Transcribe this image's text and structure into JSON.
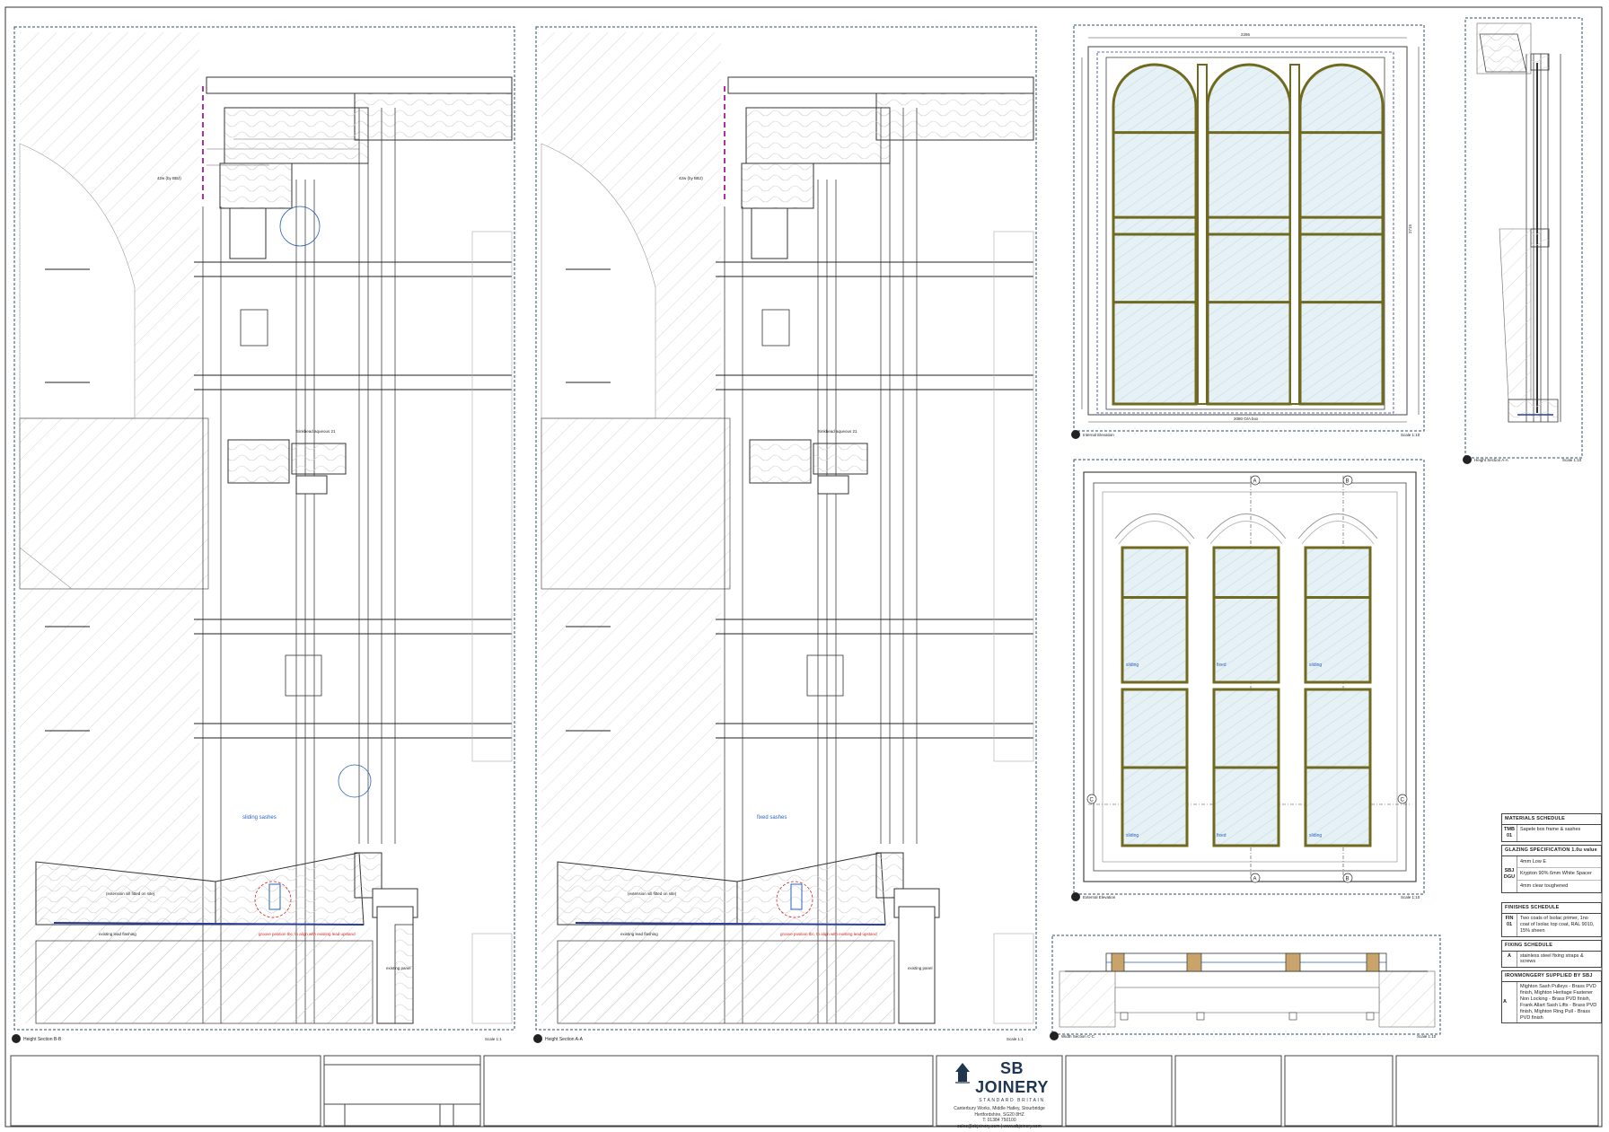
{
  "views": {
    "v1": {
      "label": "Height Section B-B",
      "scale": "Scale 1:1",
      "sash_note": "sliding sashes"
    },
    "v2": {
      "label": "Height Section A-A",
      "scale": "Scale 1:1",
      "sash_note": "fixed sashes"
    },
    "v3": {
      "label": "Internal Elevation",
      "scale": "Scale 1:10",
      "width_top": "2286",
      "width_bottom": "2080 O/A box",
      "height_right": "2715"
    },
    "v4": {
      "label": "Height Section A-A",
      "scale": "Scale 1:10"
    },
    "v5": {
      "label": "External Elevation",
      "scale": "Scale 1:10",
      "pane_labels": [
        "sliding",
        "fixed",
        "sliding"
      ]
    },
    "v6": {
      "label": "Width Section C-C",
      "scale": "Scale 1:10"
    }
  },
  "annotations": {
    "dim_pair": "42w (by BBJ)",
    "sill_note": "(extension sill fitted on site)",
    "lead": "existing lead flashing",
    "groove": "groove position tbc, to align with existing lead upstand",
    "parting": "Sinkbead aqueous 21",
    "panel": "existing panel"
  },
  "markers": {
    "a": "A",
    "b": "B",
    "c": "C"
  },
  "schedules": {
    "materials": {
      "title": "MATERIALS SCHEDULE",
      "code": "TMB 01",
      "text": "Sapele box frame & sashes"
    },
    "glazing": {
      "title": "GLAZING SPECIFICATION 1.0u value",
      "code": "SBJ DGU",
      "items": [
        "4mm Low E",
        "Krypton 90% 6mm White Spacer",
        "4mm clear toughened"
      ]
    },
    "finishes": {
      "title": "FINISHES SCHEDULE",
      "code": "FIN 01",
      "text": "Two coats of Isolac primer, 1no coat of Isolac top coat, RAL 9010, 15% sheen"
    },
    "fixing": {
      "title": "FIXING SCHEDULE",
      "code": "A",
      "text": "stainless steel fixing straps & screws"
    },
    "ironmongery": {
      "title": "IRONMONGERY SUPPLIED BY SBJ",
      "code": "A",
      "text": "Mighton Sash Pulleys - Brass PVD finish, Mighton Heritage Fastener Non Locking - Brass PVD finish, Frank Allart Sash Lifts - Brass PVD finish, Mighton Ring Pull - Brass PVD finish"
    }
  },
  "title_block": {
    "logo_name": "SB JOINERY",
    "logo_sub": "STANDARD BRITAIN",
    "address": [
      "Canterbury Works, Middle Hatley, Stourbridge",
      "Hertfordshire, SG20 8HZ",
      "T: 01384 750100"
    ],
    "contact": "sales@sbjoinery.com  |  www.sbjoinery.com"
  },
  "colors": {
    "line": "#333333",
    "glass": "#c6dde6",
    "sash": "#6f6a1f",
    "hatch": "#bbbbbb",
    "accent_blue": "#2a62b8",
    "accent_red": "#d02020",
    "accent_magenta": "#b030a0"
  }
}
